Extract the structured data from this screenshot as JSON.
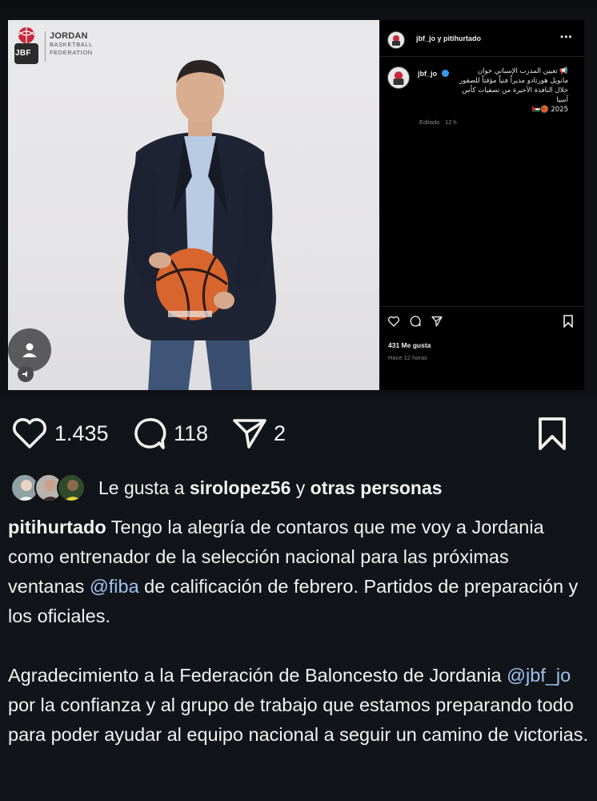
{
  "embed": {
    "logo": {
      "monogram": "JBF",
      "line1": "JORDAN",
      "line2": "BASKETBALL",
      "line3": "FEDERATION"
    },
    "panel": {
      "header_names": "jbf_jo y pitihurtado",
      "more_icon": "more-horizontal",
      "caption_user": "jbf_jo",
      "caption_lines": [
        "📢 تعيين المدرب الإسباني خوان",
        "مانويل هورتادو مديراً فنياً مؤقتاً للصقور",
        "خلال النافذة الأخيرة من تصفيات كأس آسيا",
        "2025 🏀🇯🇴"
      ],
      "edited_meta": "Editado · 12 h",
      "likes": "431 Me gusta",
      "time_ago": "Hace 12 horas"
    }
  },
  "actions": {
    "like_count": "1.435",
    "comment_count": "118",
    "share_count": "2"
  },
  "liked_by": {
    "prefix": "Le gusta a",
    "user": "sirolopez56",
    "connector": "y",
    "others": "otras personas"
  },
  "caption": {
    "user": "pitihurtado",
    "p1_text": " Tengo la alegría de contaros que me voy a Jordania como entrenador de la selección nacional para las próximas ventanas ",
    "p1_mention": "@fiba",
    "p1_tail": " de calificación de febrero. Partidos de preparación y los oficiales.",
    "p2_text": "Agradecimiento a la Federación de Baloncesto de Jordania ",
    "p2_mention": "@jbf_jo",
    "p2_tail": " por la confianza y al grupo de trabajo que estamos preparando todo para poder ayudar al equipo nacional a seguir un camino de victorias."
  },
  "colors": {
    "background": "#111419",
    "mention": "#9fc2f2",
    "verified": "#3897f0",
    "ball": "#d8642e"
  }
}
